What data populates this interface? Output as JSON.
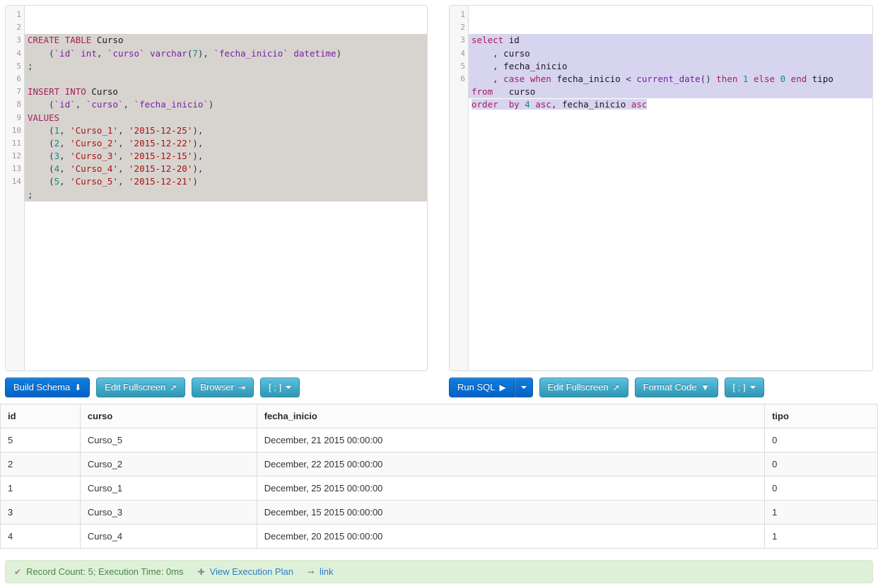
{
  "left_editor": {
    "line_count": 14,
    "line_numbers": [
      "1",
      "2",
      "3",
      "4",
      "5",
      "6",
      "7",
      "8",
      "9",
      "10",
      "11",
      "12",
      "13",
      "14"
    ],
    "code_text": "CREATE TABLE Curso\n    (`id` int, `curso` varchar(7), `fecha_inicio` datetime)\n;\n\nINSERT INTO Curso\n    (`id`, `curso`, `fecha_inicio`)\nVALUES\n    (1, 'Curso_1', '2015-12-25'),\n    (2, 'Curso_2', '2015-12-22'),\n    (3, 'Curso_3', '2015-12-15'),\n    (4, 'Curso_4', '2015-12-20'),\n    (5, 'Curso_5', '2015-12-21')\n;\n",
    "lines": [
      {
        "n": "1",
        "text": "CREATE TABLE Curso"
      },
      {
        "n": "2",
        "text": "    (`id` int, `curso` varchar(7), `fecha_inicio` datetime)"
      },
      {
        "n": "3",
        "text": ";"
      },
      {
        "n": "4",
        "text": ""
      },
      {
        "n": "5",
        "text": "INSERT INTO Curso"
      },
      {
        "n": "6",
        "text": "    (`id`, `curso`, `fecha_inicio`)"
      },
      {
        "n": "7",
        "text": "VALUES"
      },
      {
        "n": "8",
        "text": "    (1, 'Curso_1', '2015-12-25'),"
      },
      {
        "n": "9",
        "text": "    (2, 'Curso_2', '2015-12-22'),"
      },
      {
        "n": "10",
        "text": "    (3, 'Curso_3', '2015-12-15'),"
      },
      {
        "n": "11",
        "text": "    (4, 'Curso_4', '2015-12-20'),"
      },
      {
        "n": "12",
        "text": "    (5, 'Curso_5', '2015-12-21')"
      },
      {
        "n": "13",
        "text": ";"
      },
      {
        "n": "14",
        "text": ""
      }
    ]
  },
  "right_editor": {
    "line_count": 6,
    "line_numbers": [
      "1",
      "2",
      "3",
      "4",
      "5",
      "6"
    ],
    "code_text": "select id\n    , curso\n    , fecha_inicio\n    , case when fecha_inicio < current_date() then 1 else 0 end tipo\nfrom   curso\norder  by 4 asc, fecha_inicio asc",
    "lines": [
      {
        "n": "1",
        "text": "select id"
      },
      {
        "n": "2",
        "text": "    , curso"
      },
      {
        "n": "3",
        "text": "    , fecha_inicio"
      },
      {
        "n": "4",
        "text": "    , case when fecha_inicio < current_date() then 1 else 0 end tipo"
      },
      {
        "n": "5",
        "text": "from   curso"
      },
      {
        "n": "6",
        "text": "order  by 4 asc, fecha_inicio asc"
      }
    ]
  },
  "toolbar_left": {
    "build_schema": "Build Schema",
    "build_schema_icon": "download-icon",
    "edit_fullscreen": "Edit Fullscreen",
    "edit_fullscreen_icon": "expand-arrows-icon",
    "browser": "Browser",
    "browser_icon": "indent-icon",
    "delimiter": "[ ; ]",
    "delimiter_icon": "chevron-down-icon"
  },
  "toolbar_right": {
    "run_sql": "Run SQL",
    "run_sql_icon": "play-icon",
    "run_sql_caret_icon": "chevron-down-icon",
    "edit_fullscreen": "Edit Fullscreen",
    "edit_fullscreen_icon": "expand-arrows-icon",
    "format_code": "Format Code",
    "format_code_icon": "filter-icon",
    "delimiter": "[ ; ]",
    "delimiter_icon": "chevron-down-icon"
  },
  "results": {
    "columns": [
      "id",
      "curso",
      "fecha_inicio",
      "tipo"
    ],
    "rows": [
      [
        "5",
        "Curso_5",
        "December, 21 2015 00:00:00",
        "0"
      ],
      [
        "2",
        "Curso_2",
        "December, 22 2015 00:00:00",
        "0"
      ],
      [
        "1",
        "Curso_1",
        "December, 25 2015 00:00:00",
        "0"
      ],
      [
        "3",
        "Curso_3",
        "December, 15 2015 00:00:00",
        "1"
      ],
      [
        "4",
        "Curso_4",
        "December, 20 2015 00:00:00",
        "1"
      ]
    ]
  },
  "status": {
    "check_icon": "check-icon",
    "summary": "Record Count: 5; Execution Time: 0ms",
    "plus_icon": "plus-icon",
    "execution_plan_link": "View Execution Plan",
    "share_icon": "arrow-right-icon",
    "share_link": "link"
  },
  "colors": {
    "primary": "#0561c4",
    "info": "#2f96b4",
    "link": "#2b7dc4",
    "success_bg": "#dff0d8",
    "success_text": "#468847",
    "selection_left": "#d7d4d0",
    "selection_right": "#d7d4f0",
    "keyword": "#a71d5d",
    "keyword_alt": "#7b1fa2",
    "number": "#0b8c8c",
    "string": "#aa1111"
  }
}
